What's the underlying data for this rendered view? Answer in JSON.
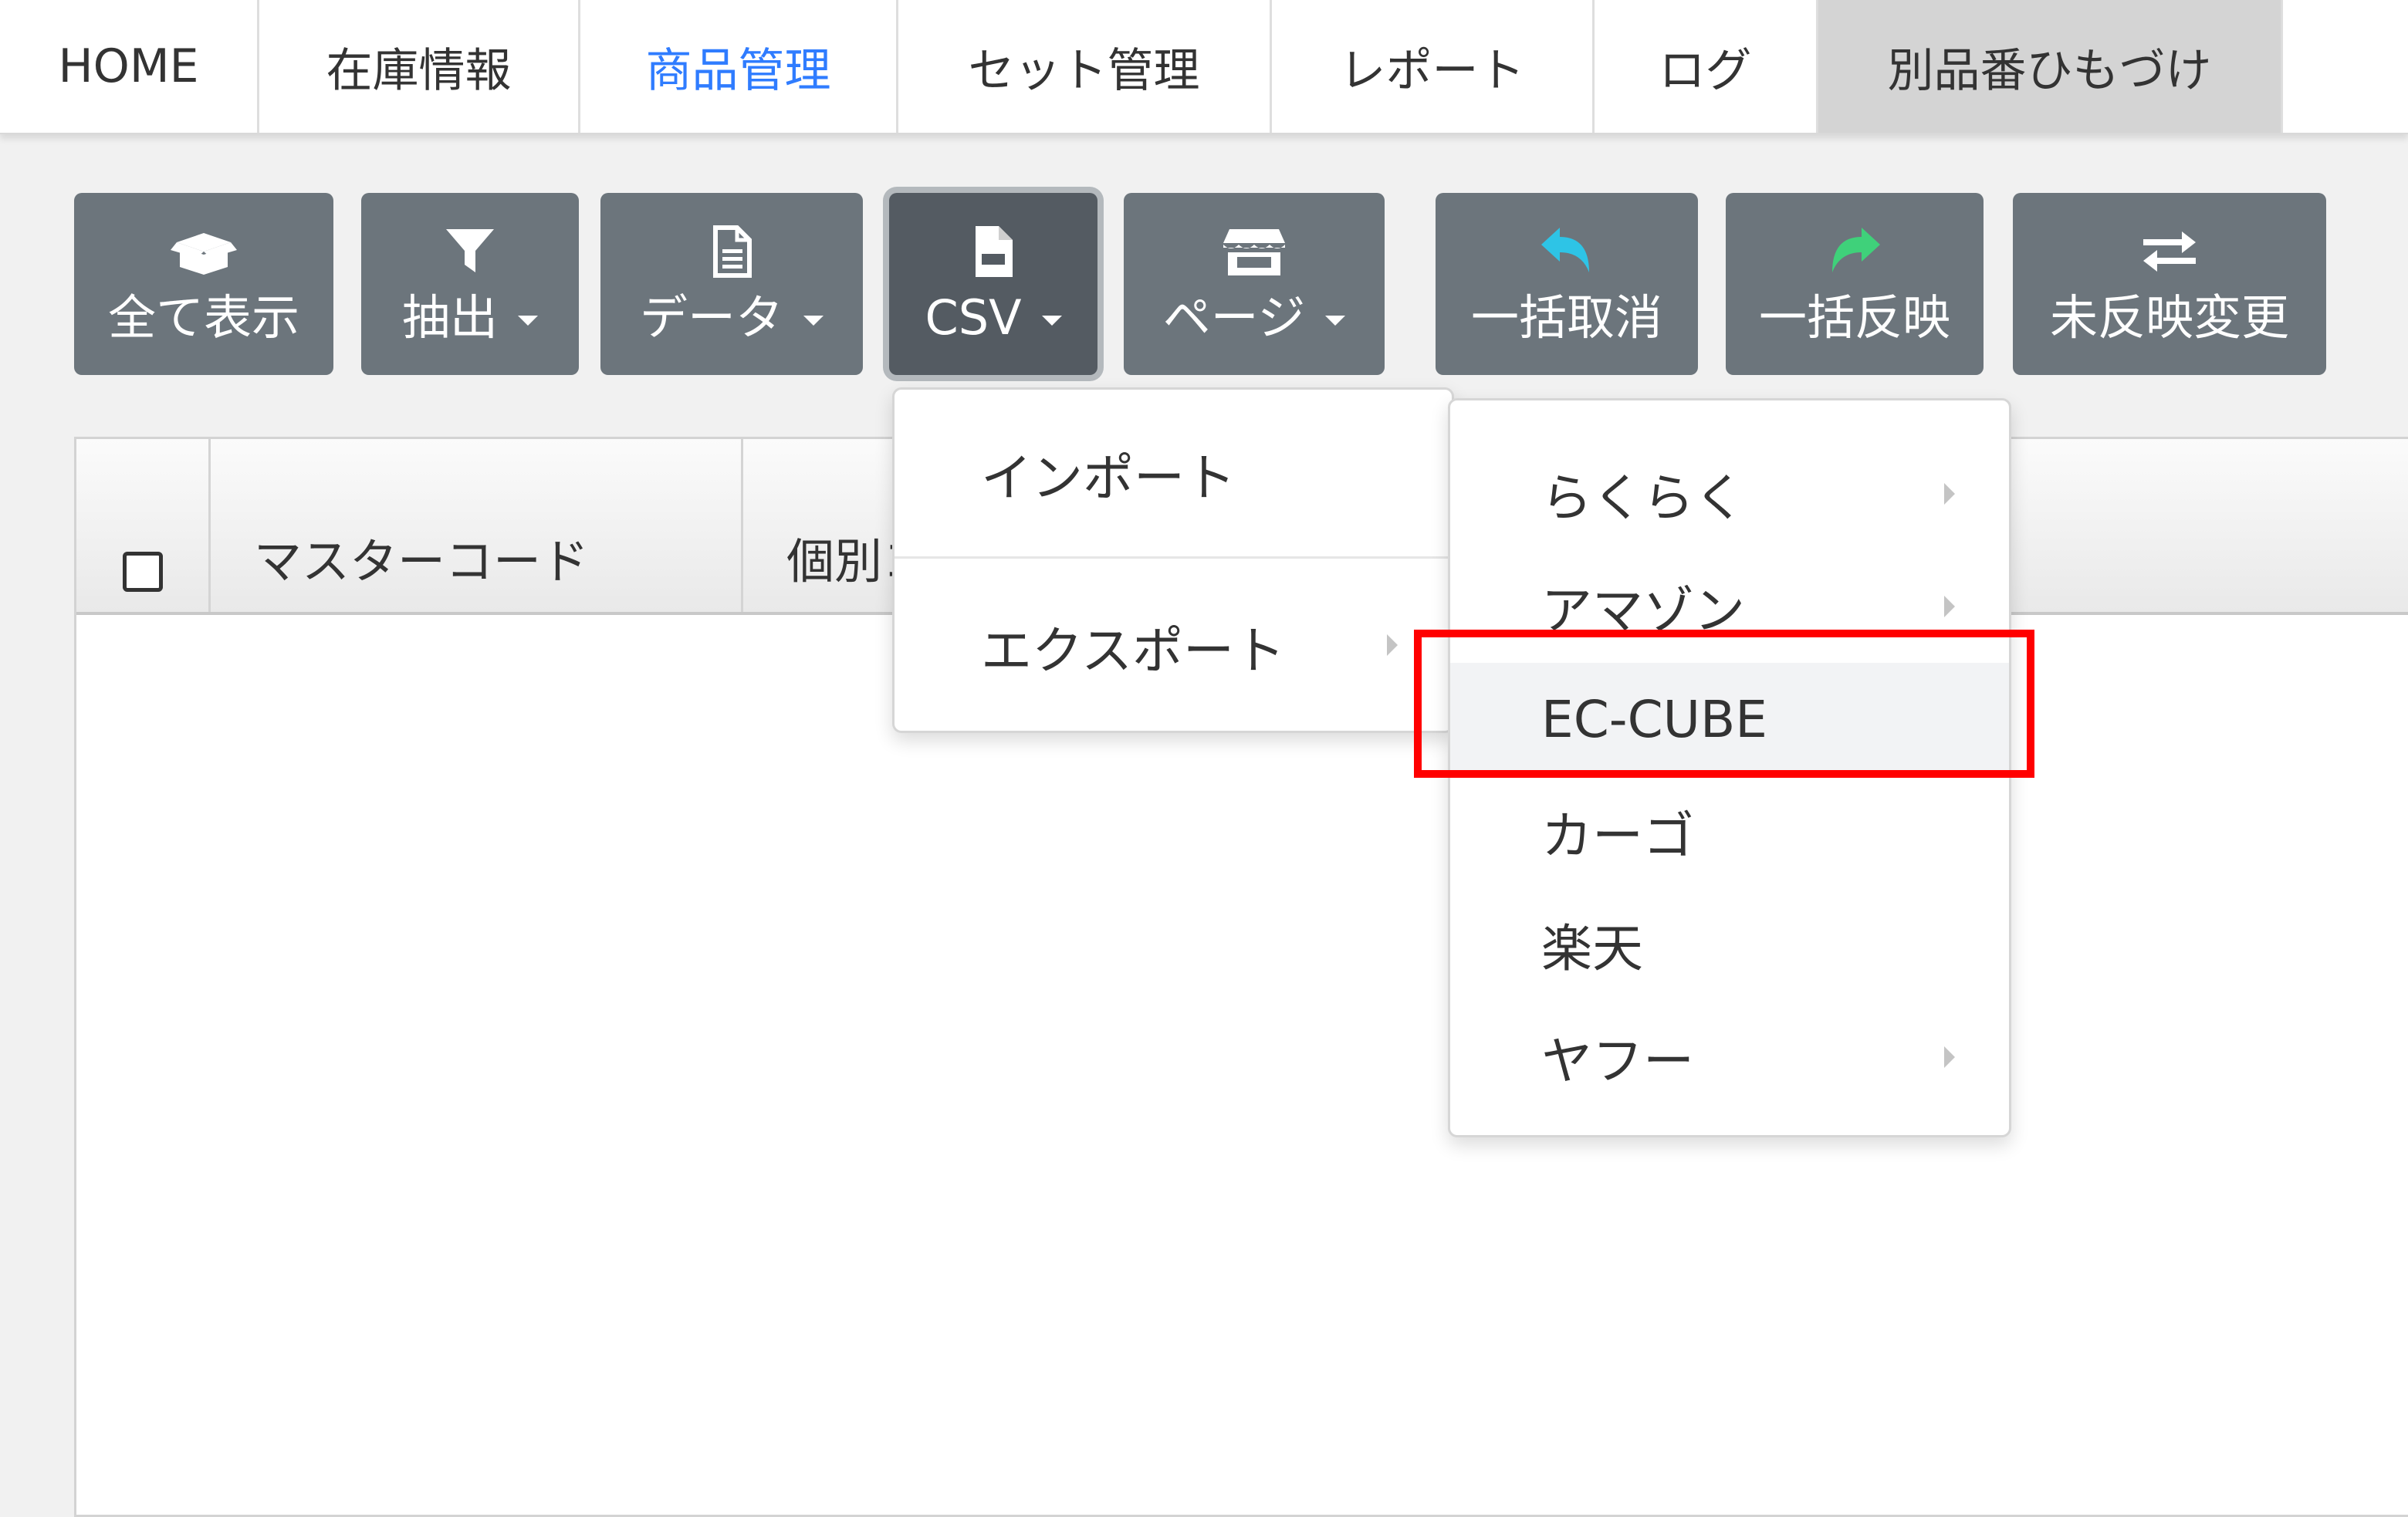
{
  "nav": {
    "items": [
      {
        "label": "HOME"
      },
      {
        "label": "在庫情報"
      },
      {
        "label": "商品管理"
      },
      {
        "label": "セット管理"
      },
      {
        "label": "レポート"
      },
      {
        "label": "ログ"
      },
      {
        "label": "別品番ひもづけ"
      }
    ],
    "active_item": "商品管理",
    "selected_item": "別品番ひもづけ"
  },
  "toolbar": {
    "buttons": [
      {
        "label": "全て表示",
        "icon": "open-box-icon",
        "dropdown": false
      },
      {
        "label": "抽出",
        "icon": "filter-icon",
        "dropdown": true
      },
      {
        "label": "データ",
        "icon": "document-icon",
        "dropdown": true
      },
      {
        "label": "CSV",
        "icon": "csv-file-icon",
        "dropdown": true,
        "pressed": true
      },
      {
        "label": "ページ",
        "icon": "store-icon",
        "dropdown": true
      },
      {
        "label": "一括取消",
        "icon": "undo-arrow-icon",
        "icon_color": "#2ec4e6",
        "dropdown": false
      },
      {
        "label": "一括反映",
        "icon": "redo-arrow-icon",
        "icon_color": "#3fd17a",
        "dropdown": false
      },
      {
        "label": "未反映変更",
        "icon": "exchange-arrows-icon",
        "dropdown": false
      }
    ]
  },
  "table": {
    "headers": [
      {
        "label": ""
      },
      {
        "label": "マスターコード"
      },
      {
        "label": "個別コード"
      }
    ]
  },
  "csv_menu": {
    "items": [
      {
        "label": "インポート",
        "has_submenu": false
      },
      {
        "label": "エクスポート",
        "has_submenu": true
      }
    ]
  },
  "export_submenu": {
    "items": [
      {
        "label": "らくらく",
        "has_submenu": true
      },
      {
        "label": "アマゾン",
        "has_submenu": true
      },
      {
        "label": "EC-CUBE",
        "has_submenu": false,
        "highlighted": true
      },
      {
        "label": "カーゴ",
        "has_submenu": false
      },
      {
        "label": "楽天",
        "has_submenu": false
      },
      {
        "label": "ヤフー",
        "has_submenu": true
      }
    ]
  },
  "colors": {
    "button_bg": "#6c757c",
    "button_pressed_bg": "#545b62",
    "active_nav_text": "#2f7cff",
    "selected_nav_bg": "#d4d4d4",
    "highlight_border": "#ff0000"
  }
}
